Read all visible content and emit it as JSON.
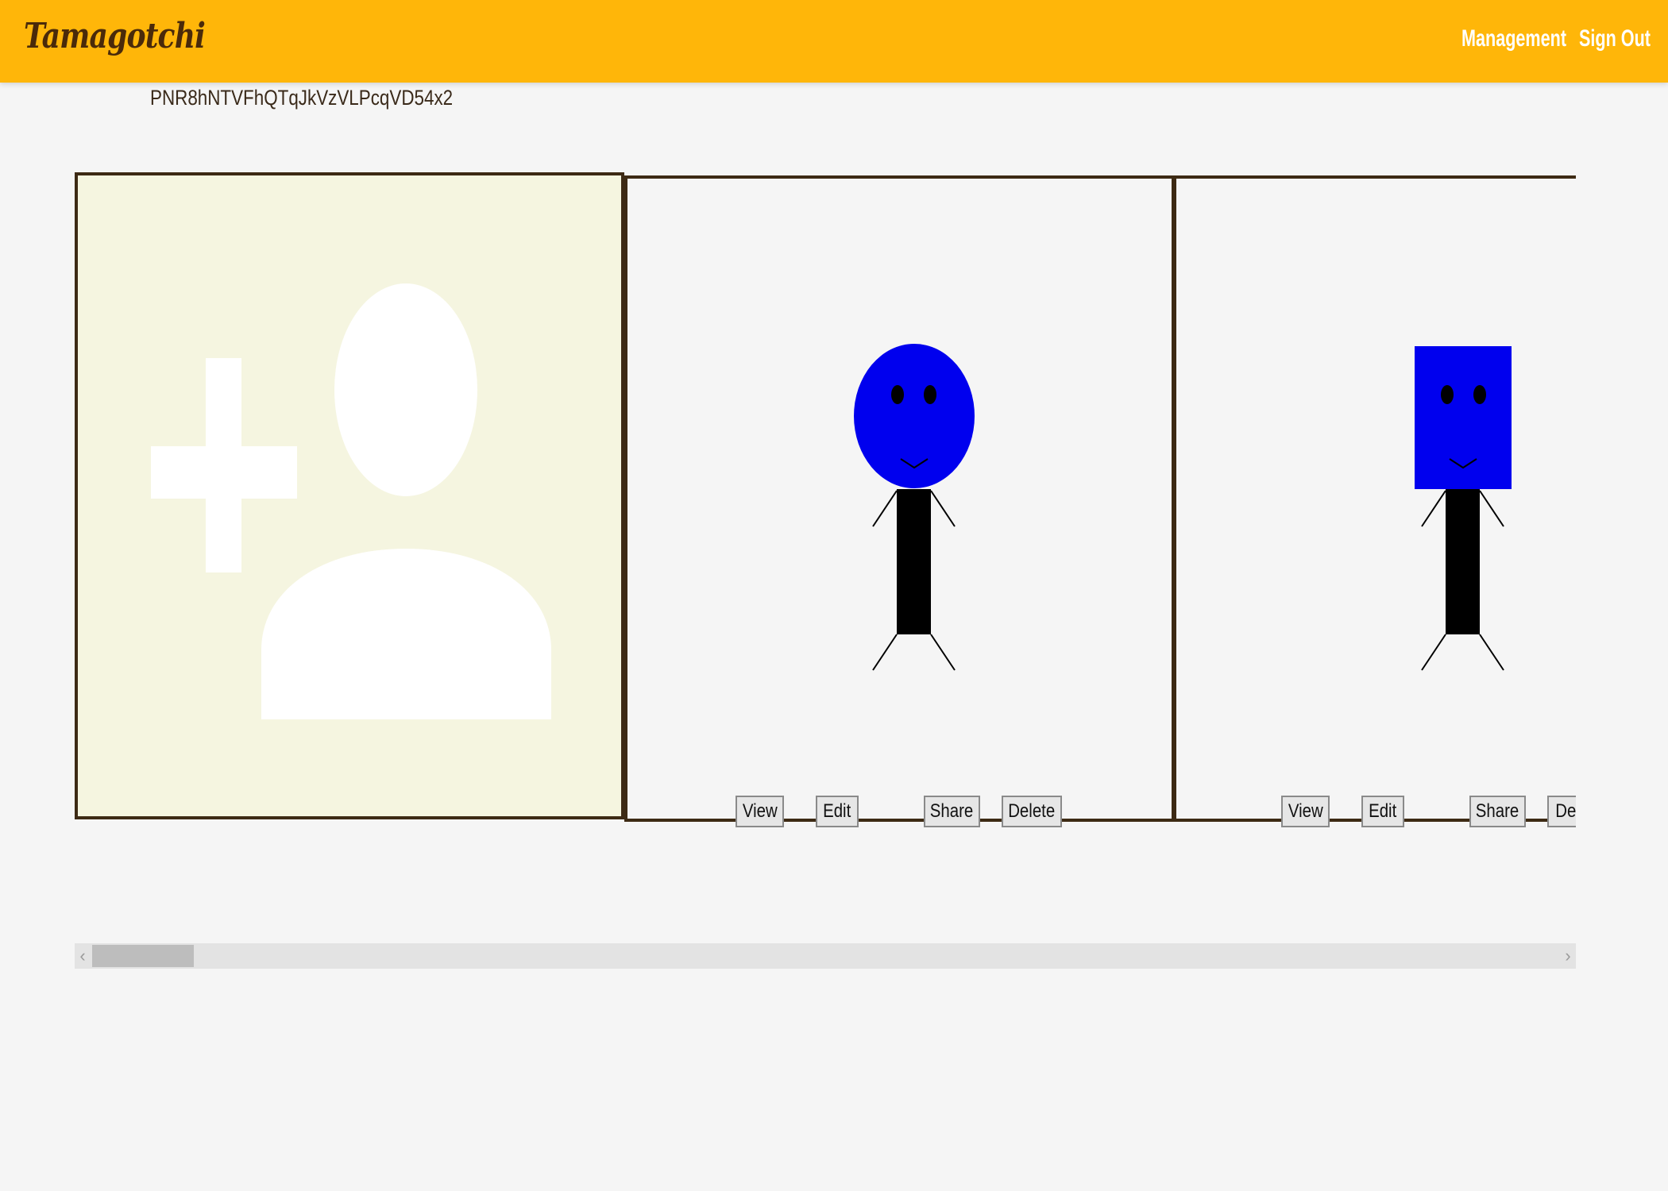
{
  "header": {
    "brand": "Tamagotchi",
    "nav": {
      "management": "Management",
      "sign_out": "Sign Out"
    },
    "bg_color": "#ffb609"
  },
  "user_id": "PNR8hNTVFhQTqJkVzVLPcqVD54x2",
  "add_pet_card": {
    "icon": "add-user-icon"
  },
  "pets": [
    {
      "head_shape": "circle",
      "color": "#0000ee",
      "buttons": {
        "view": "View",
        "edit": "Edit",
        "share": "Share",
        "delete": "Delete"
      }
    },
    {
      "head_shape": "square",
      "color": "#0000ee",
      "buttons": {
        "view": "View",
        "edit": "Edit",
        "share": "Share",
        "delete": "De"
      }
    }
  ],
  "scrollbar": {
    "left_arrow": "‹",
    "right_arrow": "›"
  }
}
